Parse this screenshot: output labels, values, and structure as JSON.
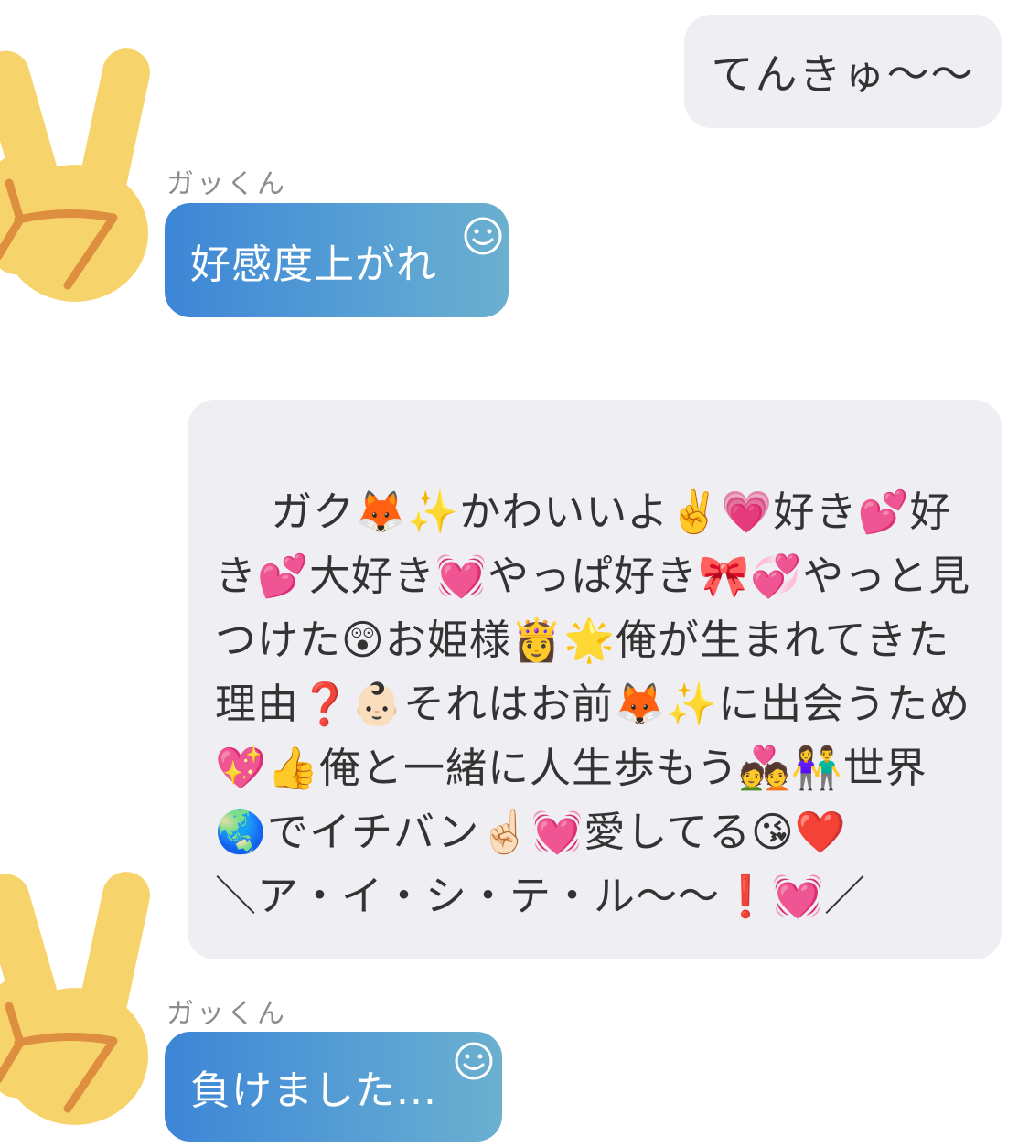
{
  "conversation": {
    "messages": [
      {
        "direction": "outgoing",
        "text": "てんきゅ〜〜"
      },
      {
        "direction": "incoming",
        "sender": "ガッくん",
        "avatar_icon": "victory-hand-icon",
        "text": "好感度上がれ",
        "reaction_icon": "smiley-icon"
      },
      {
        "direction": "outgoing",
        "text": "ガク🦊✨かわいいよ✌️💗好き💕好き💕大好き💓やっぱ好き🎀💞やっと見つけた😲お姫様👸🌟俺が生まれてきた理由❓👶🏻それはお前🦊✨に出会うため💖👍俺と一緒に人生歩もう💑👫世界🌏でイチバン☝🏻💓愛してる😘❤️\n＼ア・イ・シ・テ・ル〜〜❗️💓／"
      },
      {
        "direction": "incoming",
        "sender": "ガッくん",
        "avatar_icon": "victory-hand-icon",
        "text": "負けました...",
        "reaction_icon": "smiley-icon"
      }
    ]
  },
  "colors": {
    "incoming_bubble_start": "#3d86d6",
    "incoming_bubble_end": "#6bb0cf",
    "outgoing_bubble": "#eeeef3",
    "avatar_skin": "#f7d46b",
    "avatar_outline": "#de8e3f"
  }
}
